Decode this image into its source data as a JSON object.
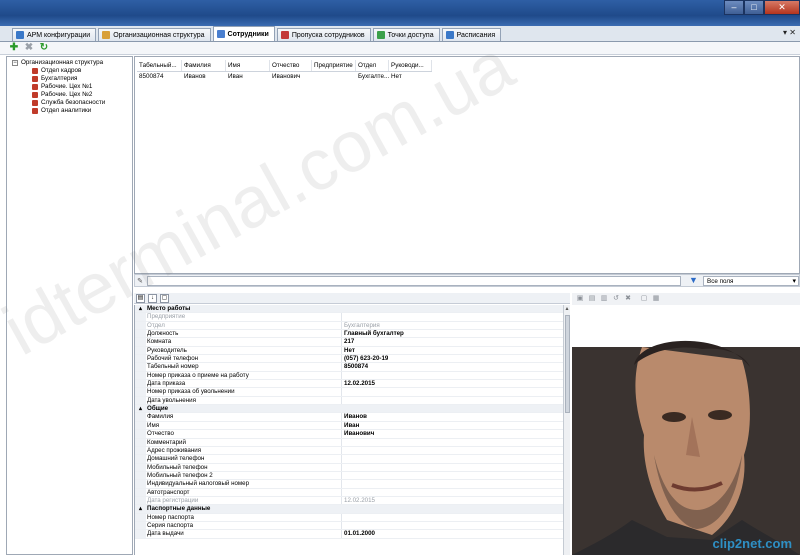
{
  "window": {
    "minimize": "–",
    "maximize": "□",
    "close": "✕"
  },
  "tabs": [
    {
      "label": "АРМ конфигурации",
      "icon": "arm-config-icon",
      "color": "#3a78c8"
    },
    {
      "label": "Организационная структура",
      "icon": "org-structure-icon",
      "color": "#d8a03a"
    },
    {
      "label": "Сотрудники",
      "icon": "employees-icon",
      "color": "#4a7fcf",
      "active": true
    },
    {
      "label": "Пропуска сотрудников",
      "icon": "passes-icon",
      "color": "#c33a3a"
    },
    {
      "label": "Точки доступа",
      "icon": "access-points-icon",
      "color": "#3ba04a"
    },
    {
      "label": "Расписания",
      "icon": "schedules-icon",
      "color": "#3a78c8"
    }
  ],
  "tab_controls": "▾ ✕",
  "toolbar": {
    "add": "✚",
    "delete": "✖",
    "refresh": "↻"
  },
  "tree": {
    "root": "Организационная структура",
    "expander": "−",
    "items": [
      "Отдел кадров",
      "Бухгалтерия",
      "Рабочие. Цех №1",
      "Рабочие. Цех №2",
      "Служба безопасности",
      "Отдел аналитики"
    ]
  },
  "grid": {
    "columns": [
      "Табельный...",
      "Фамилия",
      "Имя",
      "Отчество",
      "Предприятие",
      "Отдел",
      "Руководи..."
    ],
    "rows": [
      [
        "8500874",
        "Иванов",
        "Иван",
        "Иванович",
        "",
        "Бухгалте...",
        "Нет"
      ]
    ]
  },
  "filter": {
    "pen": "✎",
    "funnel": "▼",
    "field_value": "Все поля"
  },
  "propbar": {
    "cat": "▤",
    "az": "↓",
    "pages": "▢"
  },
  "props": [
    {
      "type": "cat",
      "name": "Место работы",
      "toggle": "▴"
    },
    {
      "type": "dis",
      "name": "Предприятие",
      "value": ""
    },
    {
      "type": "dis",
      "name": "Отдел",
      "value": "Бухгалтерия"
    },
    {
      "name": "Должность",
      "value": "Главный бухгалтер"
    },
    {
      "name": "Комната",
      "value": "217"
    },
    {
      "name": "Руководитель",
      "value": "Нет"
    },
    {
      "name": "Рабочий телефон",
      "value": "(057) 623-20-19"
    },
    {
      "name": "Табельный номер",
      "value": "8500874"
    },
    {
      "name": "Номер приказа о приеме на работу",
      "value": ""
    },
    {
      "name": "Дата приказа",
      "value": "12.02.2015"
    },
    {
      "name": "Номер приказа об увольнении",
      "value": ""
    },
    {
      "name": "Дата увольнения",
      "value": ""
    },
    {
      "type": "cat",
      "name": "Общие",
      "toggle": "▴"
    },
    {
      "name": "Фамилия",
      "value": "Иванов"
    },
    {
      "name": "Имя",
      "value": "Иван"
    },
    {
      "name": "Отчество",
      "value": "Иванович"
    },
    {
      "name": "Комментарий",
      "value": ""
    },
    {
      "name": "Адрес проживания",
      "value": ""
    },
    {
      "name": "Домашний телефон",
      "value": ""
    },
    {
      "name": "Мобильный телефон",
      "value": ""
    },
    {
      "name": "Мобильный телефон 2",
      "value": ""
    },
    {
      "name": "Индивидуальный налоговый номер",
      "value": ""
    },
    {
      "name": "Автотранспорт",
      "value": ""
    },
    {
      "type": "dis",
      "name": "Дата регистрации",
      "value": "12.02.2015"
    },
    {
      "type": "cat",
      "name": "Паспортные данные",
      "toggle": "▴"
    },
    {
      "name": "Номер паспорта",
      "value": ""
    },
    {
      "name": "Серия паспорта",
      "value": ""
    },
    {
      "name": "Дата выдачи",
      "value": "01.01.2000"
    }
  ],
  "scroll": {
    "up": "▴",
    "down": "▾"
  },
  "photo_tools": [
    "▣",
    "▤",
    "▥",
    "↺",
    "✖",
    "▢",
    "▦"
  ],
  "watermark": "idterminal.com.ua",
  "clip_logo": "clip2net.com"
}
